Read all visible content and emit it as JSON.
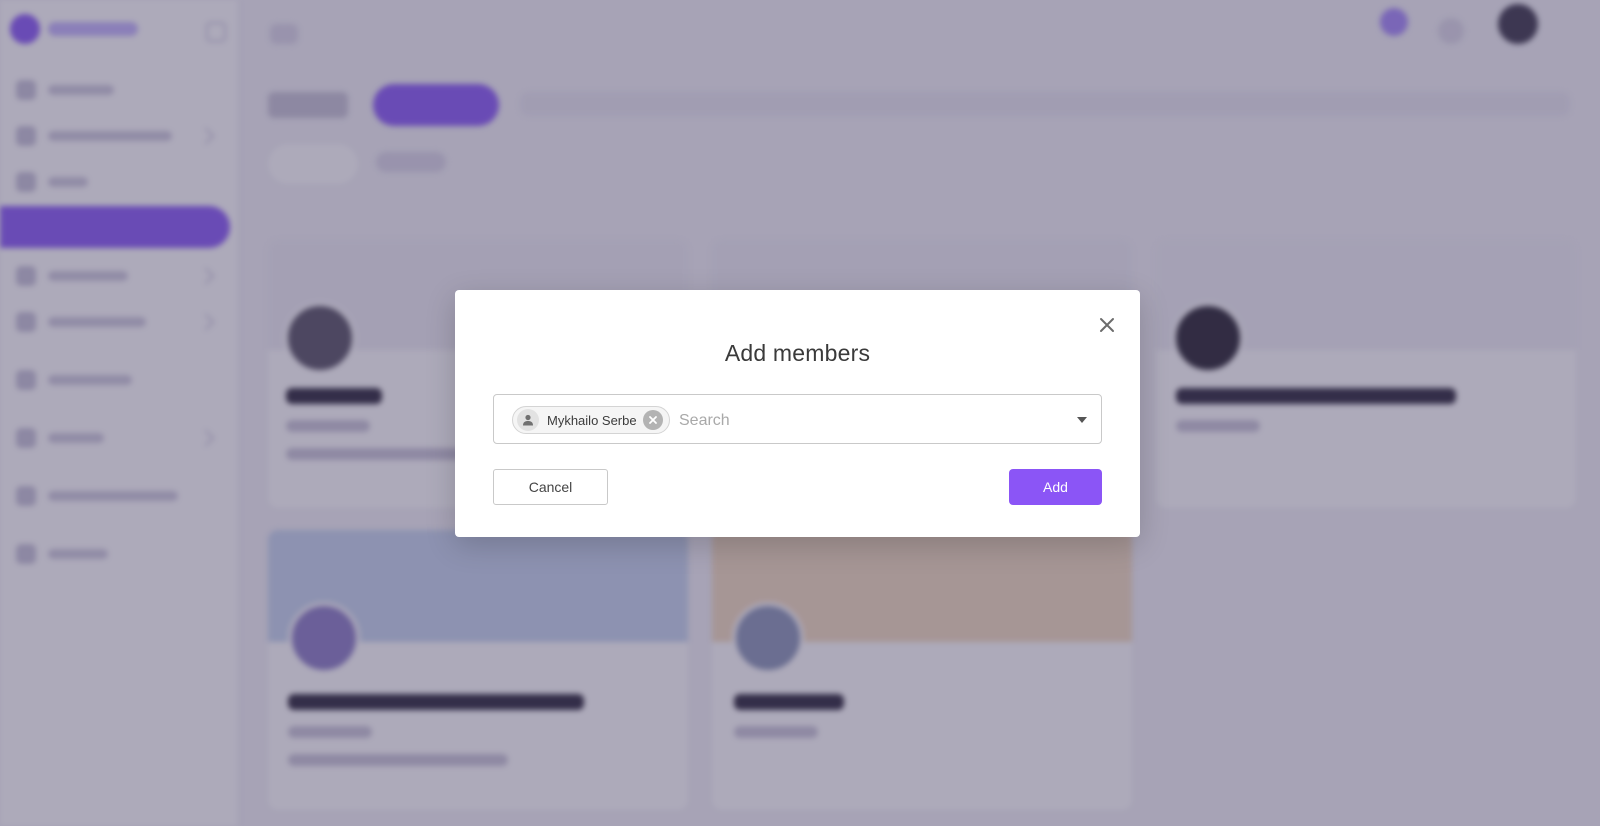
{
  "modal": {
    "title": "Add members",
    "selected_members": [
      {
        "name": "Mykhailo Serbe"
      }
    ],
    "search": {
      "placeholder": "Search",
      "value": ""
    },
    "cancel_label": "Cancel",
    "add_label": "Add",
    "close_icon": "close-icon"
  },
  "colors": {
    "accent": "#8b55f6",
    "overlay": "rgba(60,52,90,0.42)"
  }
}
